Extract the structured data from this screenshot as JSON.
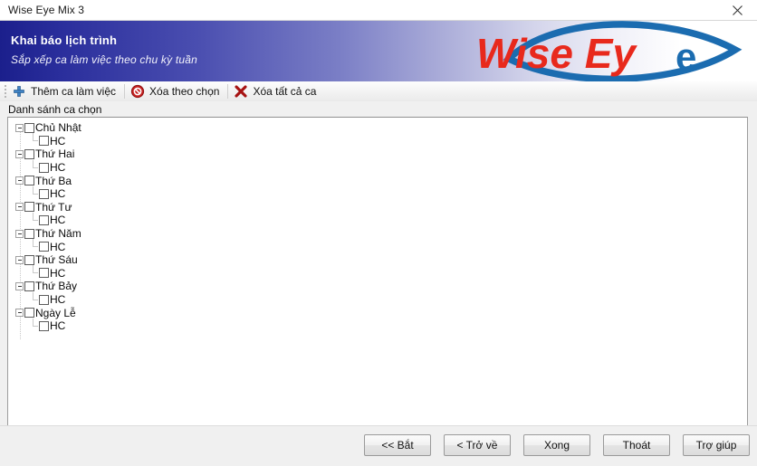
{
  "window": {
    "title": "Wise Eye Mix 3",
    "close_icon": "close-icon"
  },
  "banner": {
    "title": "Khai báo lịch trình",
    "subtitle": "Sắp xếp ca làm việc theo chu kỳ tuần",
    "logo_text_1": "Wise",
    "logo_text_2": "Ey",
    "logo_text_3": "e",
    "logo_red": "#e8291c",
    "logo_blue": "#1b6cb0",
    "gradient_start": "#1b1f8c",
    "gradient_end": "#ffffff"
  },
  "toolbar": {
    "items": [
      {
        "label": "Thêm ca làm việc",
        "icon": "plus-icon"
      },
      {
        "label": "Xóa theo chọn",
        "icon": "delete-circle-icon"
      },
      {
        "label": "Xóa tất cả ca",
        "icon": "x-mark-icon"
      }
    ]
  },
  "main": {
    "group_label": "Danh sánh ca chọn",
    "tree": [
      {
        "label": "Chủ Nhật",
        "children": [
          {
            "label": "HC"
          }
        ]
      },
      {
        "label": "Thứ Hai",
        "children": [
          {
            "label": "HC"
          }
        ]
      },
      {
        "label": "Thứ Ba",
        "children": [
          {
            "label": "HC"
          }
        ]
      },
      {
        "label": "Thứ Tư",
        "children": [
          {
            "label": "HC"
          }
        ]
      },
      {
        "label": "Thứ Năm",
        "children": [
          {
            "label": "HC"
          }
        ]
      },
      {
        "label": "Thứ Sáu",
        "children": [
          {
            "label": "HC"
          }
        ]
      },
      {
        "label": "Thứ Bảy",
        "children": [
          {
            "label": "HC"
          }
        ]
      },
      {
        "label": "Ngày Lễ",
        "children": [
          {
            "label": "HC"
          }
        ]
      }
    ]
  },
  "footer": {
    "buttons": [
      {
        "label": "<<  Bắt",
        "name": "start-button"
      },
      {
        "label": "<  Trở về",
        "name": "back-button"
      },
      {
        "label": "Xong",
        "name": "finish-button"
      },
      {
        "label": "Thoát",
        "name": "exit-button"
      },
      {
        "label": "Trợ giúp",
        "name": "help-button"
      }
    ]
  }
}
